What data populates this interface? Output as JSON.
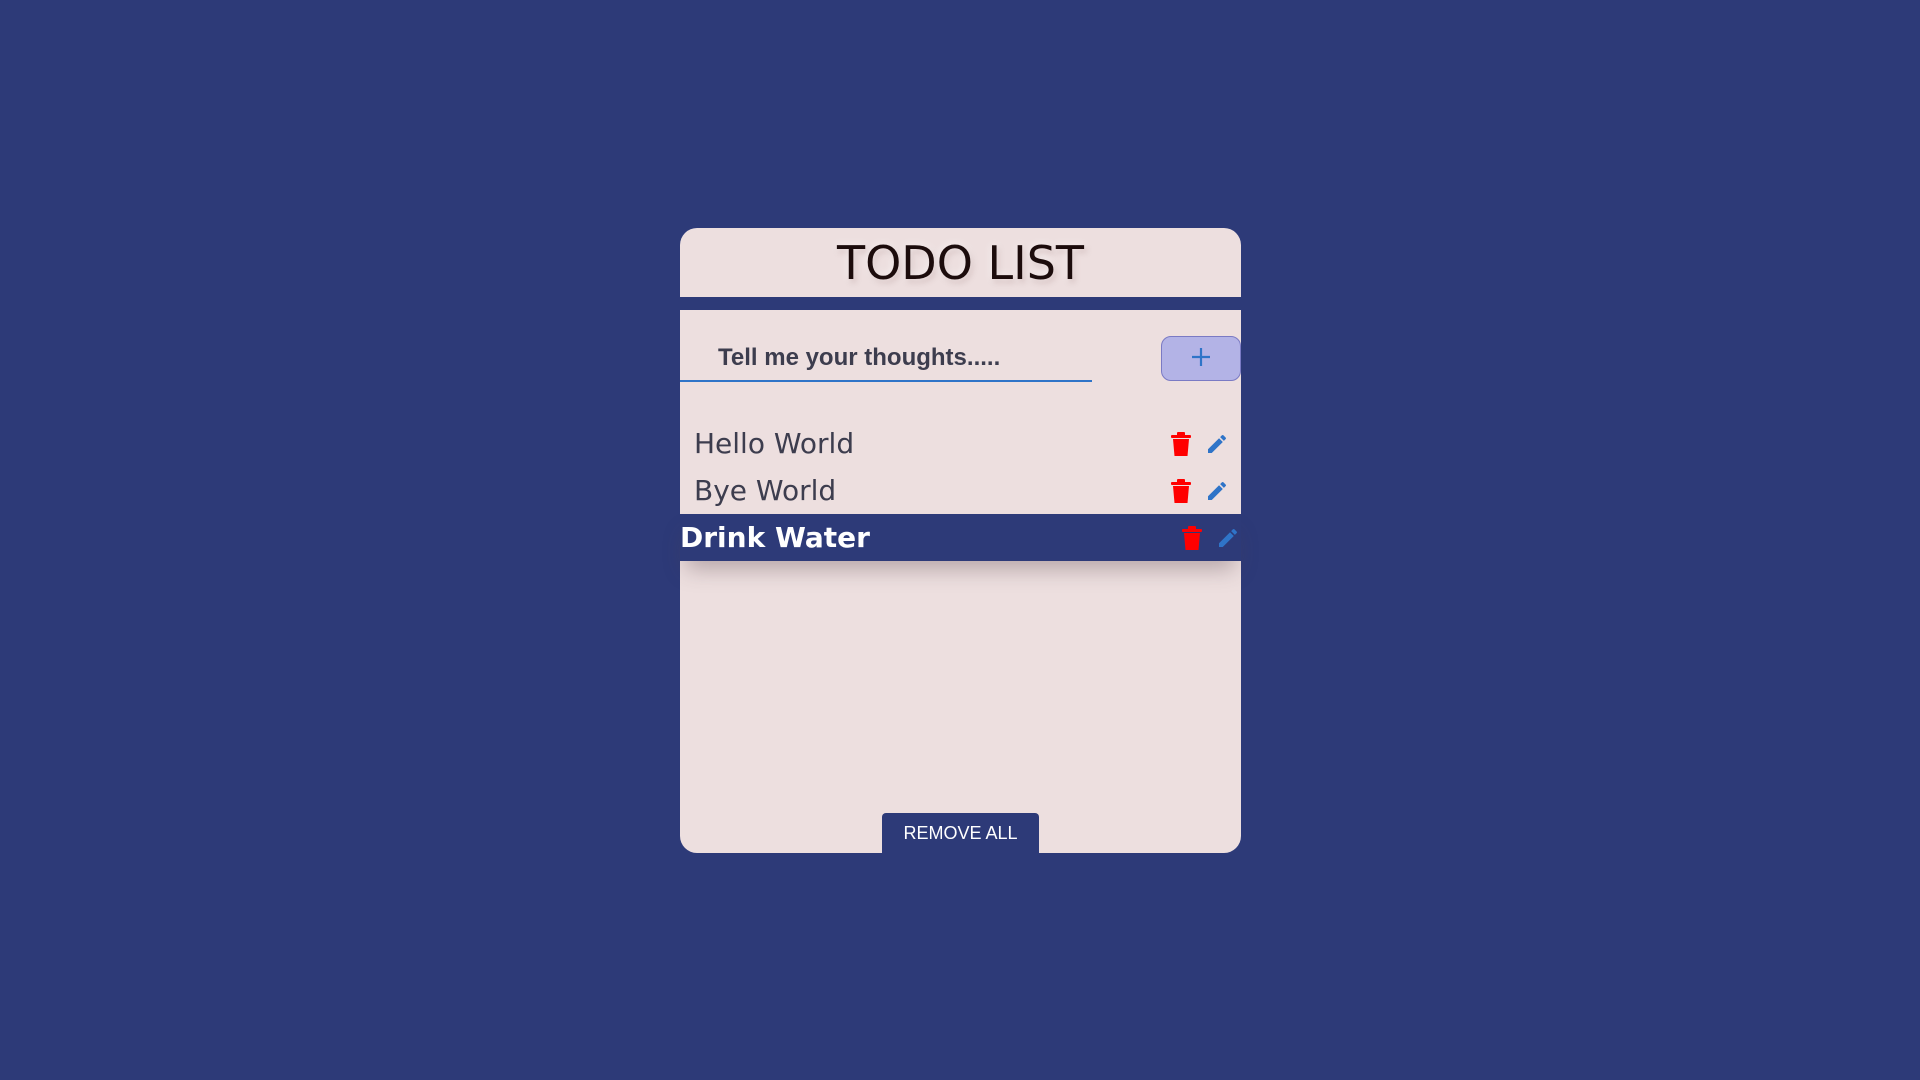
{
  "header": {
    "title": "TODO LIST"
  },
  "input": {
    "placeholder": "Tell me your thoughts.....",
    "value": ""
  },
  "add_button": {
    "icon": "plus-icon"
  },
  "todos": [
    {
      "label": "Hello World",
      "selected": false,
      "delete_icon": "trash-icon",
      "edit_icon": "pencil-icon"
    },
    {
      "label": "Bye World",
      "selected": false,
      "delete_icon": "trash-icon",
      "edit_icon": "pencil-icon"
    },
    {
      "label": "Drink Water",
      "selected": true,
      "delete_icon": "trash-icon",
      "edit_icon": "pencil-icon"
    }
  ],
  "footer": {
    "remove_all_label": "REMOVE ALL"
  },
  "colors": {
    "background": "#2d3a78",
    "card": "#eddfdf",
    "delete_icon": "#ff0000",
    "edit_icon": "#2f74c8",
    "add_button": "#b3b3e6"
  }
}
